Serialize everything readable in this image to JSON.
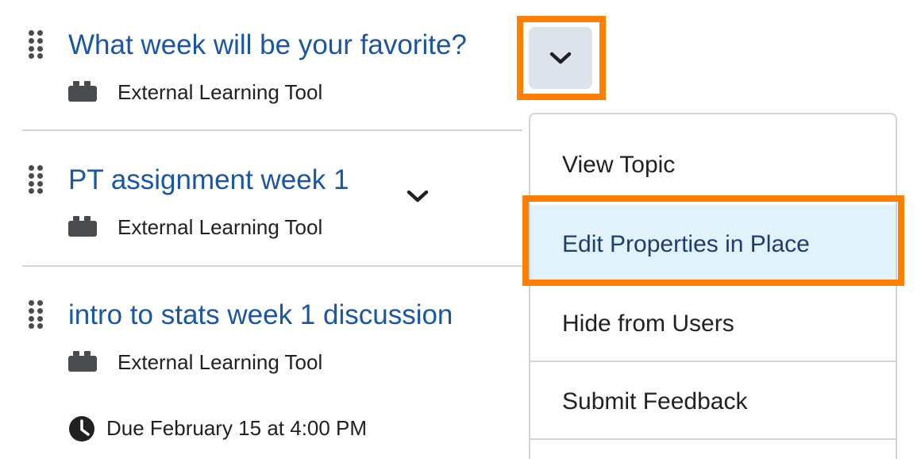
{
  "topics": [
    {
      "title": "What week will be your favorite?",
      "type_label": "External Learning Tool",
      "type_icon": "lego-block-icon"
    },
    {
      "title": "PT assignment week 1",
      "type_label": "External Learning Tool",
      "type_icon": "lego-block-icon"
    },
    {
      "title": "intro to stats week 1 discussion",
      "type_label": "External Learning Tool",
      "type_icon": "lego-block-icon",
      "due": "Due February 15 at 4:00 PM"
    }
  ],
  "context_menu": {
    "items": [
      {
        "label": "View Topic"
      },
      {
        "label": "Edit Properties in Place",
        "highlighted": true
      },
      {
        "label": "Hide from Users"
      },
      {
        "label": "Submit Feedback"
      }
    ]
  },
  "colors": {
    "link": "#1a56a8",
    "highlight_outline": "#ff7f00",
    "menu_hover_bg": "#e2f2fb",
    "button_active_bg": "#dde3ea"
  }
}
